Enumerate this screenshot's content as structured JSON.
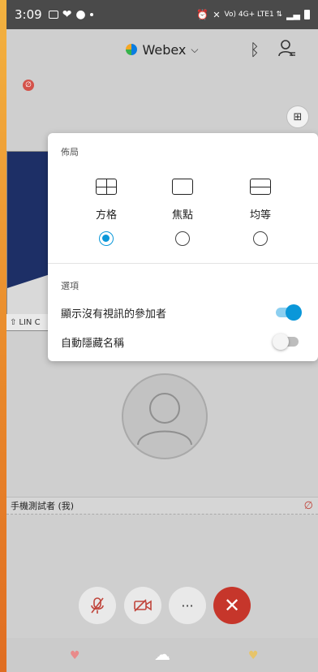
{
  "status_bar": {
    "time": "3:09",
    "network_labels": "Vo) 4G+ LTE1 ⇅"
  },
  "header": {
    "app_name": "Webex",
    "brand_color": "#0a7de0"
  },
  "layout_menu": {
    "section_title": "佈局",
    "options": [
      {
        "label": "方格",
        "selected": true,
        "icon": "grid-icon"
      },
      {
        "label": "焦點",
        "selected": false,
        "icon": "focus-icon"
      },
      {
        "label": "均等",
        "selected": false,
        "icon": "stack-icon"
      }
    ],
    "options_section_title": "選項",
    "show_no_video_label": "顯示沒有視訊的參加者",
    "show_no_video_on": true,
    "auto_hide_names_label": "自動隱藏名稱",
    "auto_hide_names_on": false,
    "accent_color": "#0a97d9"
  },
  "shared_tile": {
    "label": "LIN C"
  },
  "self_view": {
    "name": "手機測試者 (我)"
  },
  "controls": {
    "mute_icon": "mic-off-icon",
    "video_icon": "video-off-icon",
    "more_label": "···",
    "end_label": "✕",
    "end_color": "#c6362b"
  }
}
